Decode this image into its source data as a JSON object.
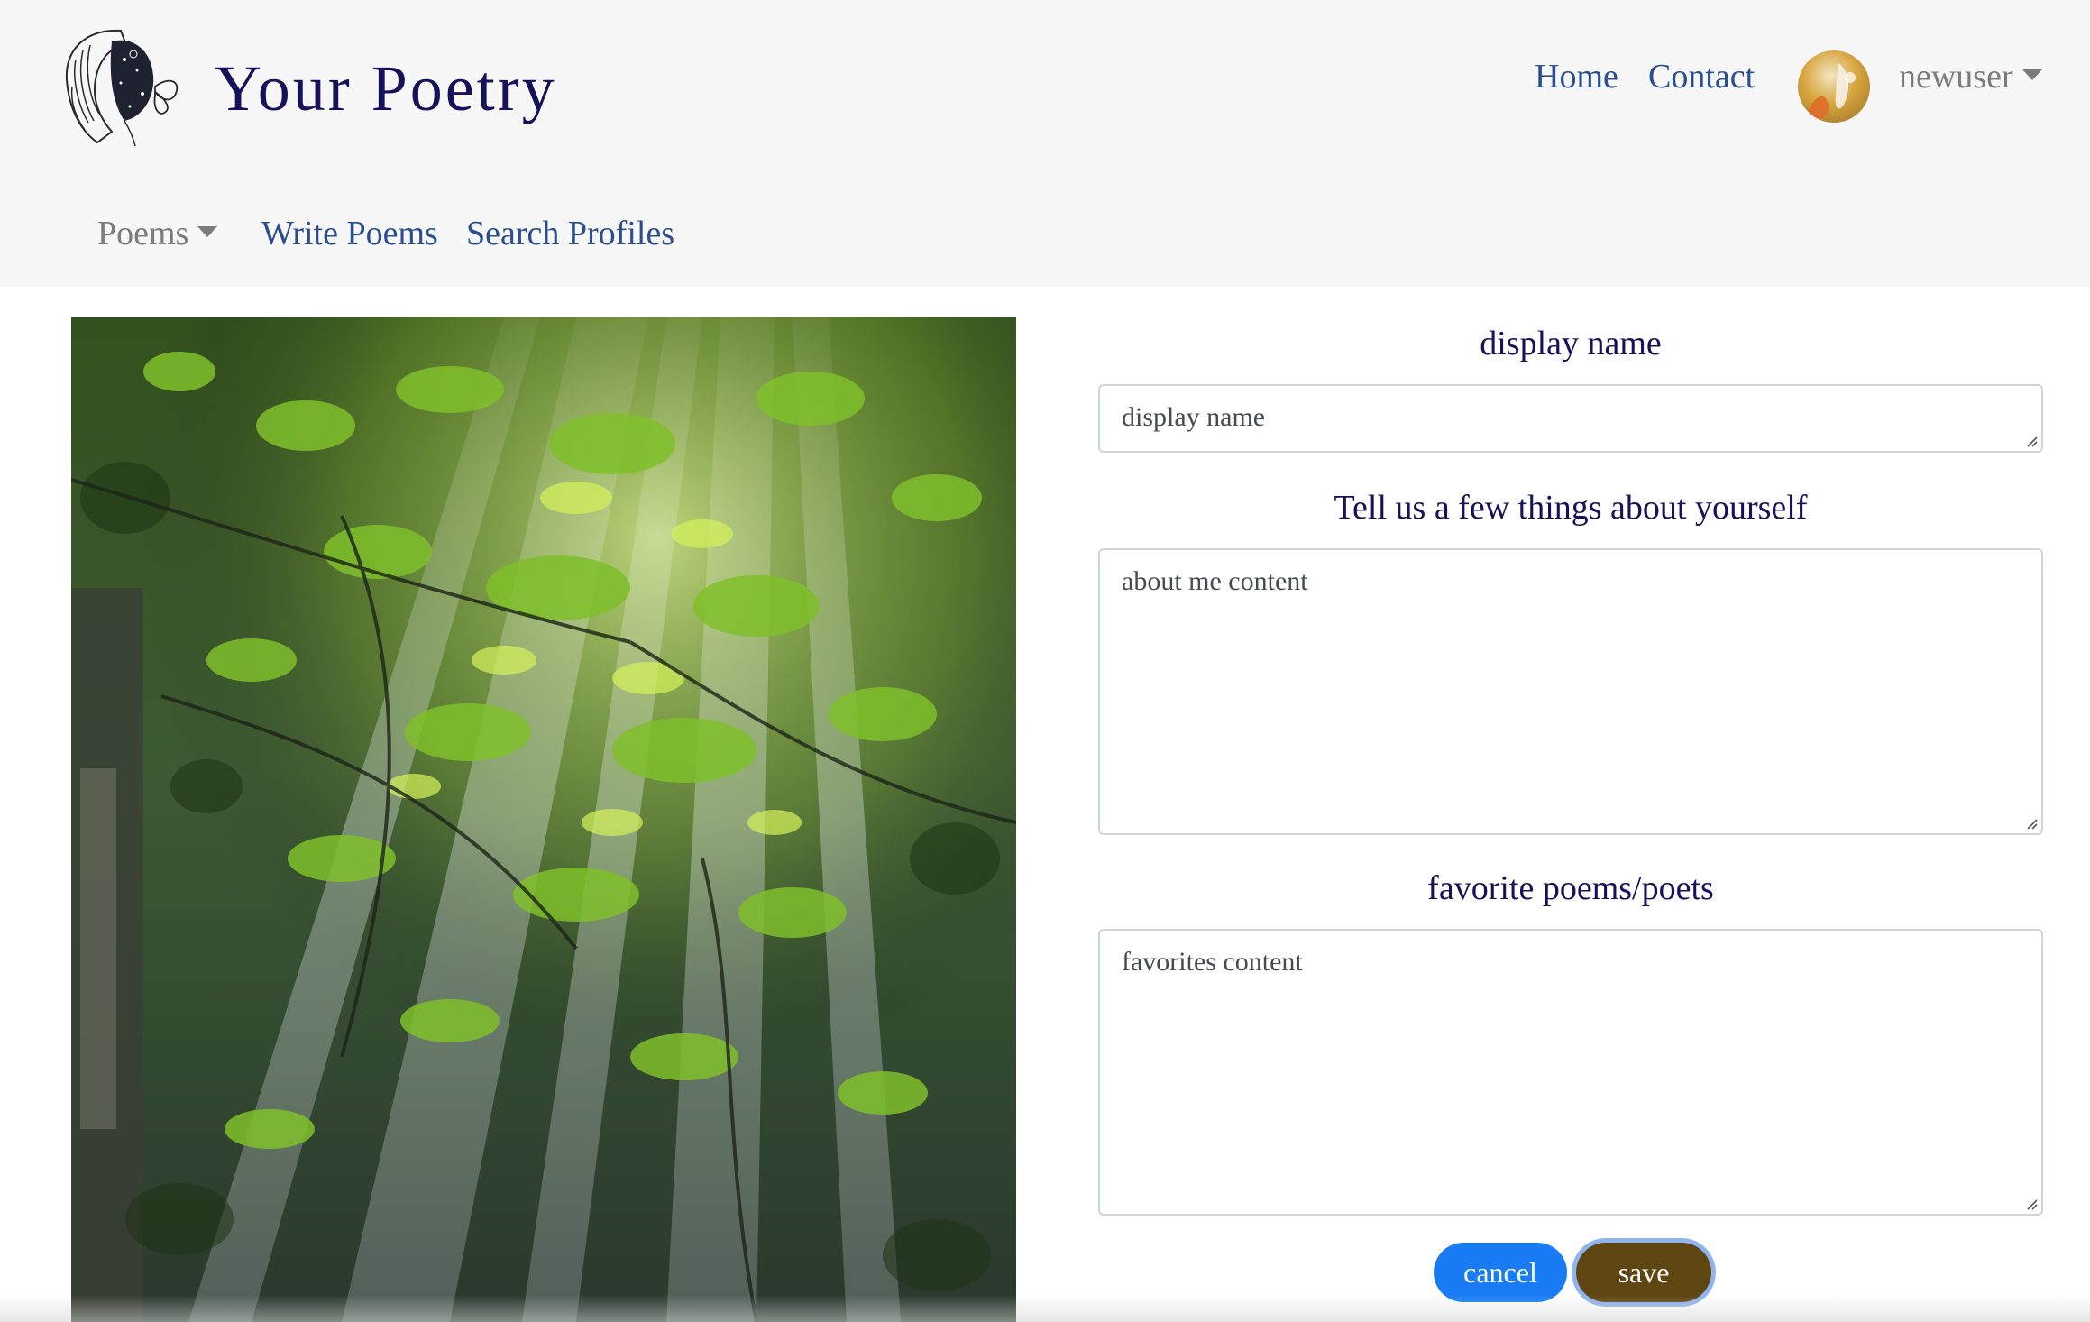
{
  "app": {
    "title": "Your Poetry"
  },
  "nav": {
    "home": "Home",
    "contact": "Contact",
    "username": "newuser",
    "poems": "Poems",
    "write_poems": "Write Poems",
    "search_profiles": "Search Profiles"
  },
  "form": {
    "display_name_label": "display name",
    "display_name_placeholder": "display name",
    "about_label": "Tell us a few things about yourself",
    "about_placeholder": "about me content",
    "favorites_label": "favorite poems/poets",
    "favorites_placeholder": "favorites content",
    "cancel": "cancel",
    "save": "save"
  },
  "icons": {
    "logo": "poet-woman-butterfly-logo",
    "avatar": "user-avatar",
    "dropdown": "caret-down-icon"
  },
  "colors": {
    "navbar_bg": "#f7f7f7",
    "brand": "#16125a",
    "link": "#2b4f8e",
    "muted": "#7c7c7c",
    "cancel_bg": "#1a7cf5",
    "save_bg": "#5e4612"
  }
}
